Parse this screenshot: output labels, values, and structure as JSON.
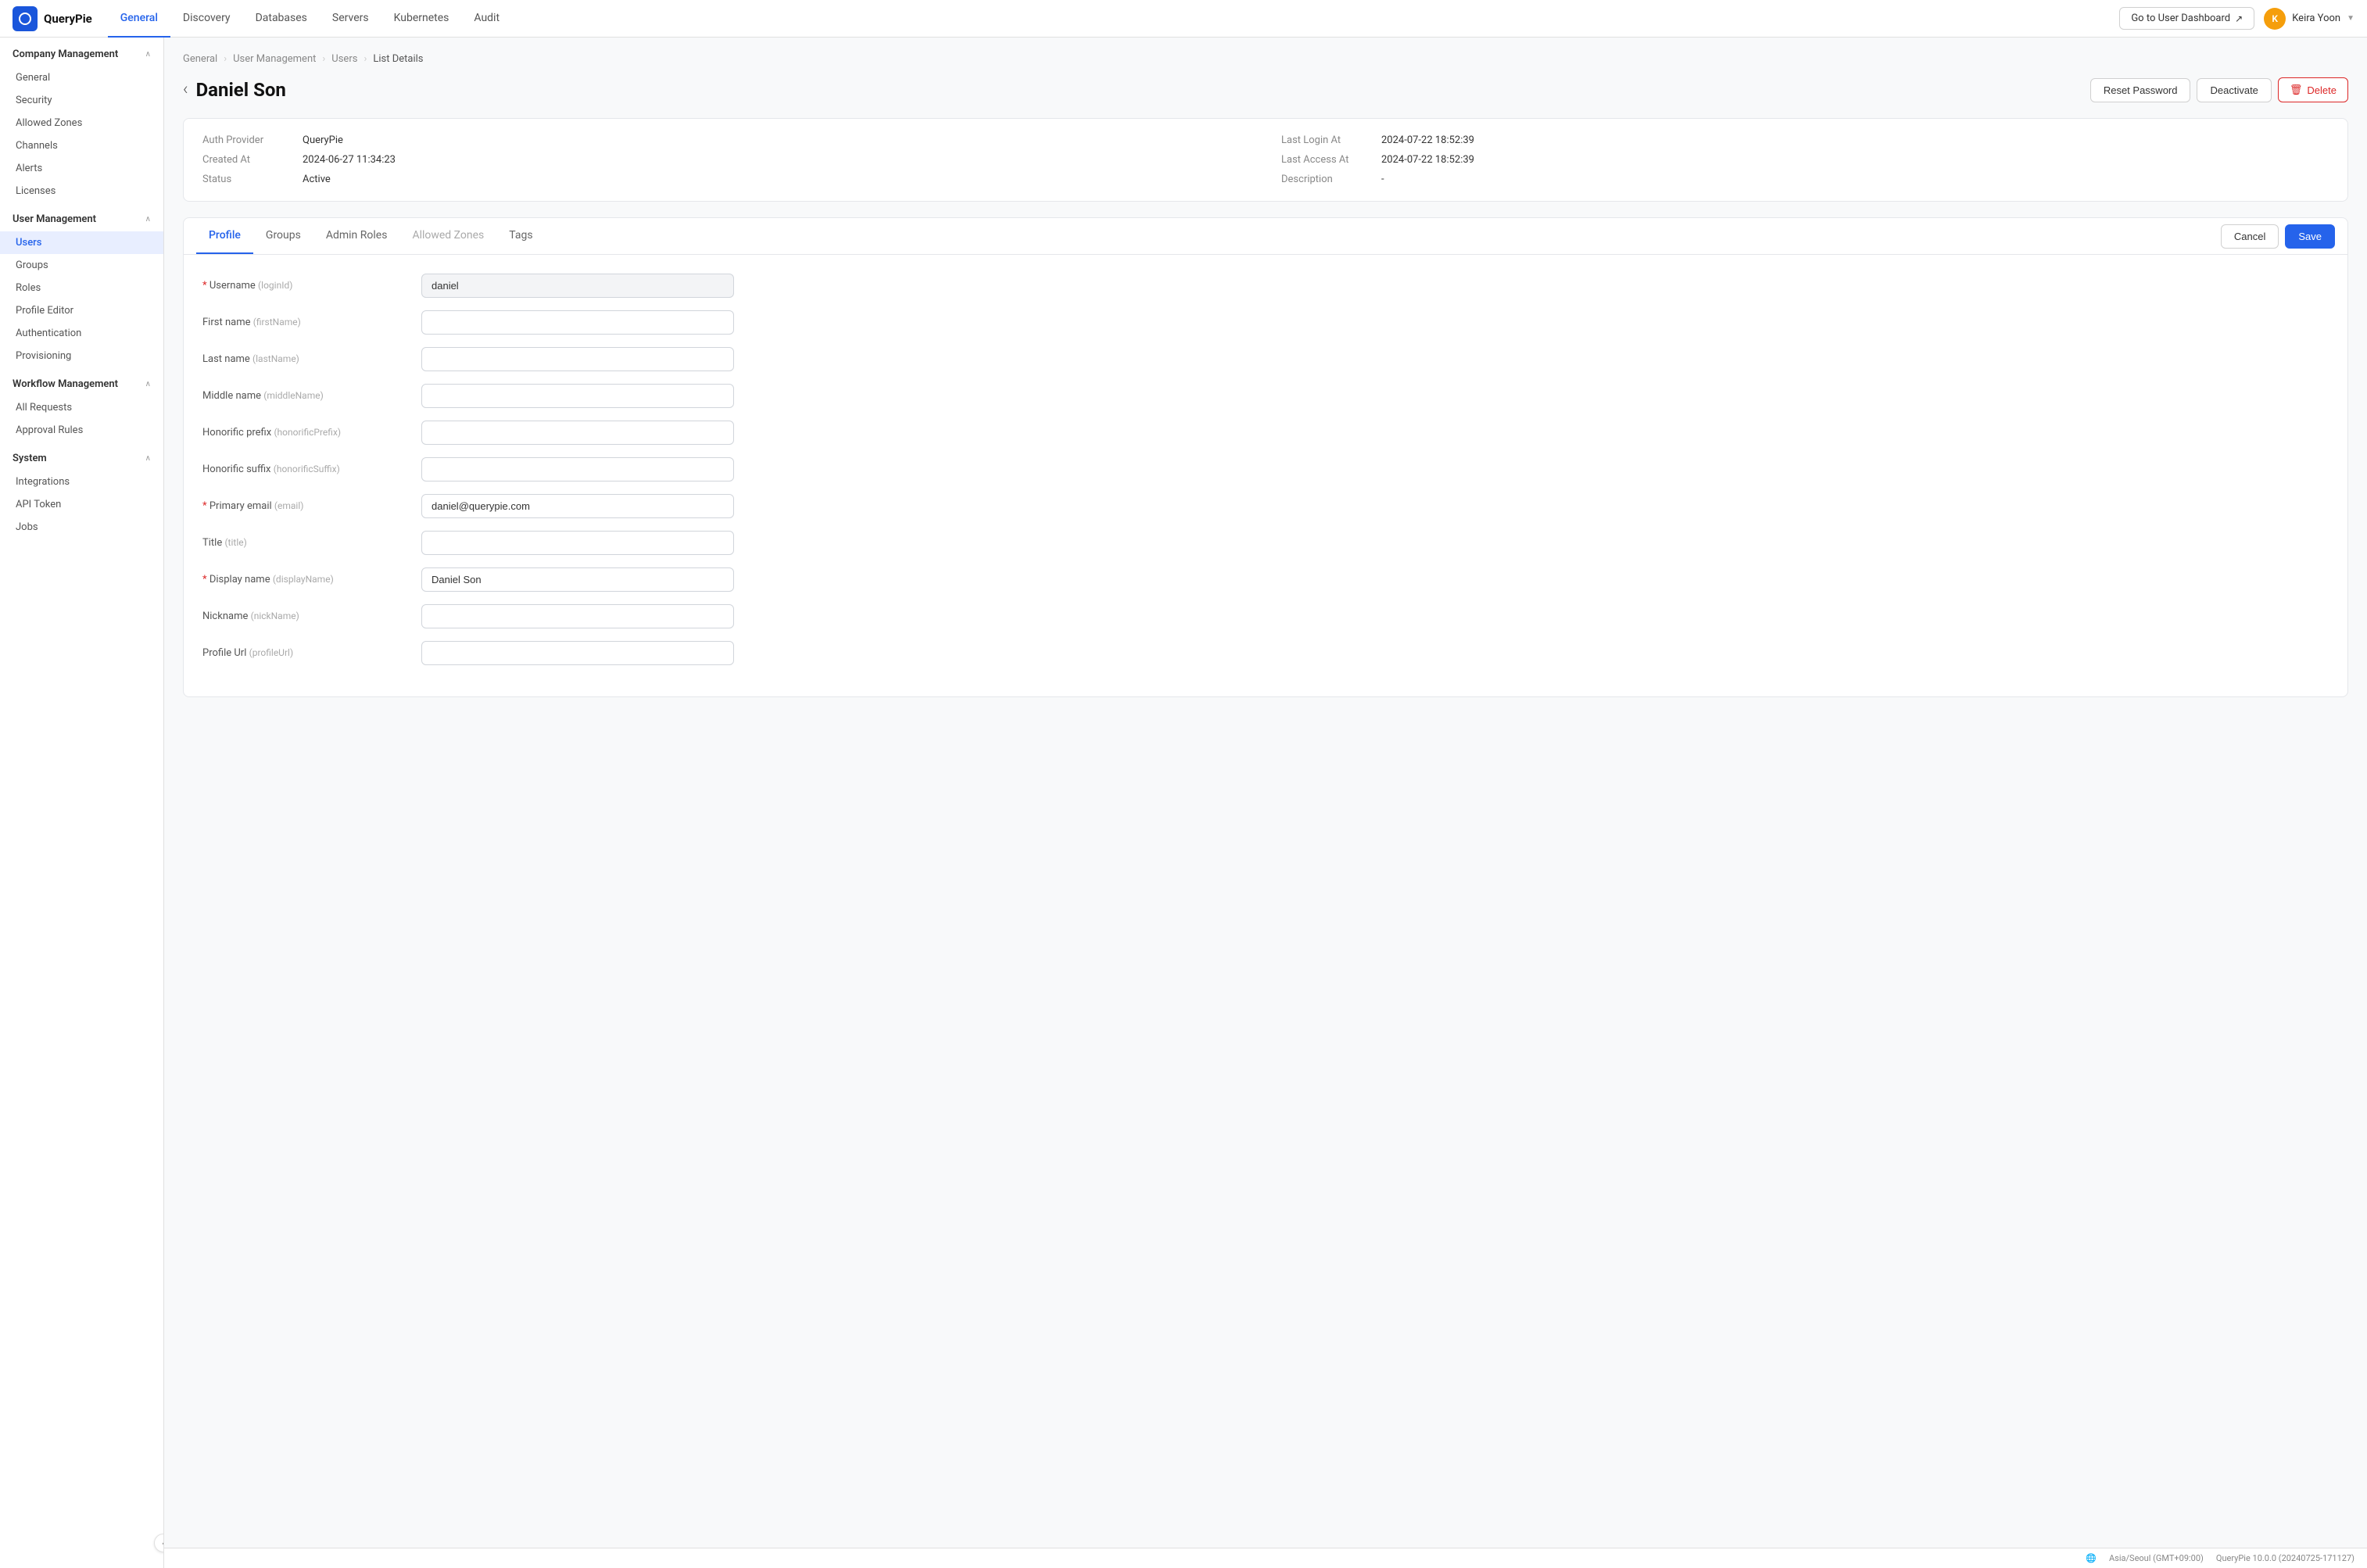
{
  "app": {
    "logo_text": "Q",
    "name": "QueryPie"
  },
  "top_nav": {
    "tabs": [
      {
        "id": "general",
        "label": "General",
        "active": true
      },
      {
        "id": "discovery",
        "label": "Discovery",
        "active": false
      },
      {
        "id": "databases",
        "label": "Databases",
        "active": false
      },
      {
        "id": "servers",
        "label": "Servers",
        "active": false
      },
      {
        "id": "kubernetes",
        "label": "Kubernetes",
        "active": false
      },
      {
        "id": "audit",
        "label": "Audit",
        "active": false
      }
    ],
    "goto_dashboard": "Go to User Dashboard",
    "user_name": "Keira Yoon",
    "user_initials": "K"
  },
  "sidebar": {
    "company_management": {
      "header": "Company Management",
      "items": [
        {
          "id": "general",
          "label": "General"
        },
        {
          "id": "security",
          "label": "Security"
        },
        {
          "id": "allowed-zones",
          "label": "Allowed Zones"
        },
        {
          "id": "channels",
          "label": "Channels"
        },
        {
          "id": "alerts",
          "label": "Alerts"
        },
        {
          "id": "licenses",
          "label": "Licenses"
        }
      ]
    },
    "user_management": {
      "header": "User Management",
      "items": [
        {
          "id": "users",
          "label": "Users",
          "active": true
        },
        {
          "id": "groups",
          "label": "Groups"
        },
        {
          "id": "roles",
          "label": "Roles"
        },
        {
          "id": "profile-editor",
          "label": "Profile Editor"
        },
        {
          "id": "authentication",
          "label": "Authentication"
        },
        {
          "id": "provisioning",
          "label": "Provisioning"
        }
      ]
    },
    "workflow_management": {
      "header": "Workflow Management",
      "items": [
        {
          "id": "all-requests",
          "label": "All Requests"
        },
        {
          "id": "approval-rules",
          "label": "Approval Rules"
        }
      ]
    },
    "system": {
      "header": "System",
      "items": [
        {
          "id": "integrations",
          "label": "Integrations"
        },
        {
          "id": "api-token",
          "label": "API Token"
        },
        {
          "id": "jobs",
          "label": "Jobs"
        }
      ]
    }
  },
  "breadcrumb": {
    "items": [
      "General",
      "User Management",
      "Users",
      "List Details"
    ]
  },
  "page": {
    "title": "Daniel Son",
    "back_label": "‹"
  },
  "header_buttons": {
    "reset_password": "Reset Password",
    "deactivate": "Deactivate",
    "delete": "Delete"
  },
  "info_card": {
    "auth_provider_label": "Auth Provider",
    "auth_provider_value": "QueryPie",
    "created_at_label": "Created At",
    "created_at_value": "2024-06-27 11:34:23",
    "status_label": "Status",
    "status_value": "Active",
    "last_login_at_label": "Last Login At",
    "last_login_at_value": "2024-07-22 18:52:39",
    "last_access_at_label": "Last Access At",
    "last_access_at_value": "2024-07-22 18:52:39",
    "description_label": "Description",
    "description_value": "-"
  },
  "profile_tabs": {
    "tabs": [
      {
        "id": "profile",
        "label": "Profile",
        "active": true,
        "disabled": false
      },
      {
        "id": "groups",
        "label": "Groups",
        "active": false,
        "disabled": false
      },
      {
        "id": "admin-roles",
        "label": "Admin Roles",
        "active": false,
        "disabled": false
      },
      {
        "id": "allowed-zones",
        "label": "Allowed Zones",
        "active": false,
        "disabled": true
      },
      {
        "id": "tags",
        "label": "Tags",
        "active": false,
        "disabled": false
      }
    ],
    "cancel_label": "Cancel",
    "save_label": "Save"
  },
  "form": {
    "fields": [
      {
        "id": "username",
        "label": "Username",
        "hint": "(loginId)",
        "required": true,
        "value": "daniel",
        "placeholder": ""
      },
      {
        "id": "first-name",
        "label": "First name",
        "hint": "(firstName)",
        "required": false,
        "value": "",
        "placeholder": ""
      },
      {
        "id": "last-name",
        "label": "Last name",
        "hint": "(lastName)",
        "required": false,
        "value": "",
        "placeholder": ""
      },
      {
        "id": "middle-name",
        "label": "Middle name",
        "hint": "(middleName)",
        "required": false,
        "value": "",
        "placeholder": ""
      },
      {
        "id": "honorific-prefix",
        "label": "Honorific prefix",
        "hint": "(honorificPrefix)",
        "required": false,
        "value": "",
        "placeholder": ""
      },
      {
        "id": "honorific-suffix",
        "label": "Honorific suffix",
        "hint": "(honorificSuffix)",
        "required": false,
        "value": "",
        "placeholder": ""
      },
      {
        "id": "primary-email",
        "label": "Primary email",
        "hint": "(email)",
        "required": true,
        "value": "daniel@querypie.com",
        "placeholder": ""
      },
      {
        "id": "title",
        "label": "Title",
        "hint": "(title)",
        "required": false,
        "value": "",
        "placeholder": ""
      },
      {
        "id": "display-name",
        "label": "Display name",
        "hint": "(displayName)",
        "required": true,
        "value": "Daniel Son",
        "placeholder": ""
      },
      {
        "id": "nickname",
        "label": "Nickname",
        "hint": "(nickName)",
        "required": false,
        "value": "",
        "placeholder": ""
      },
      {
        "id": "profile-url",
        "label": "Profile Url",
        "hint": "(profileUrl)",
        "required": false,
        "value": "",
        "placeholder": ""
      }
    ]
  },
  "status_bar": {
    "timezone": "Asia/Seoul (GMT+09:00)",
    "version": "QueryPie 10.0.0 (20240725-171127)"
  },
  "icons": {
    "chevron_right": "›",
    "chevron_down": "∨",
    "chevron_up": "∧",
    "back": "‹",
    "external_link": "↗",
    "trash": "🗑",
    "collapse": "‹"
  }
}
